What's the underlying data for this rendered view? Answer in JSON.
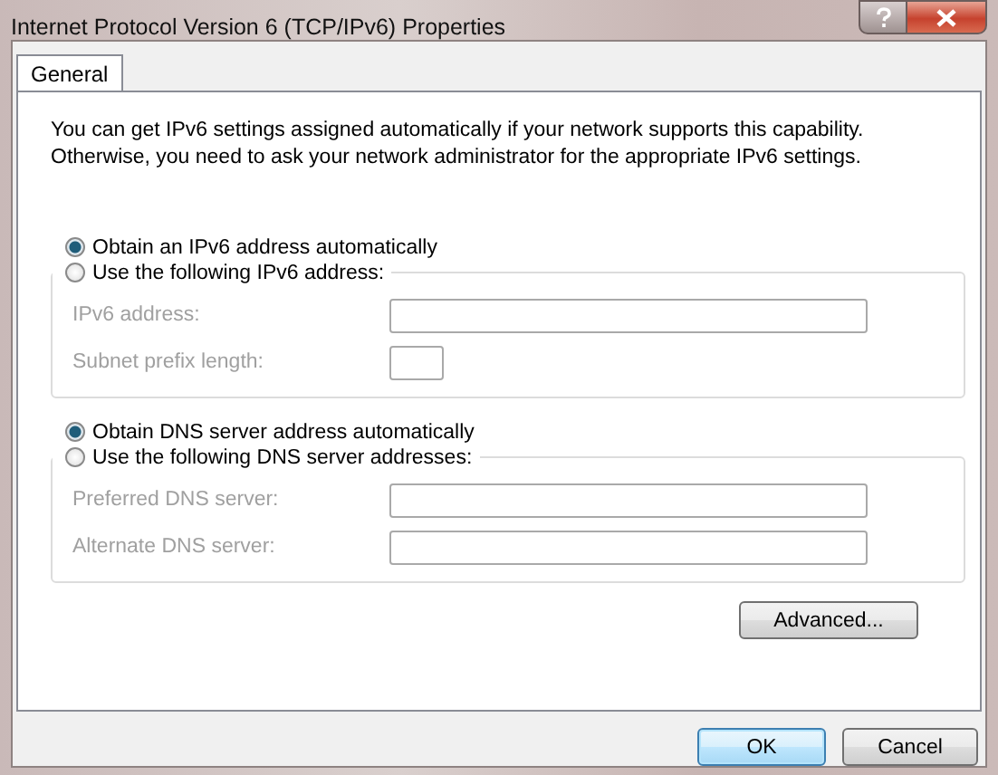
{
  "window": {
    "title": "Internet Protocol Version 6 (TCP/IPv6) Properties"
  },
  "tabs": [
    {
      "label": "General",
      "selected": true
    }
  ],
  "description": "You can get IPv6 settings assigned automatically if your network supports this capability. Otherwise, you need to ask your network administrator for the appropriate IPv6 settings.",
  "sections": [
    {
      "auto_option": {
        "label": "Obtain an IPv6 address automatically",
        "selected": true
      },
      "manual_option": {
        "label": "Use the following IPv6 address:",
        "selected": false
      },
      "fields": [
        {
          "label": "IPv6 address:",
          "kind": "long",
          "disabled": true
        },
        {
          "label": "Subnet prefix length:",
          "kind": "short",
          "disabled": true
        }
      ]
    },
    {
      "auto_option": {
        "label": "Obtain DNS server address automatically",
        "selected": true
      },
      "manual_option": {
        "label": "Use the following DNS server addresses:",
        "selected": false
      },
      "fields": [
        {
          "label": "Preferred DNS server:",
          "kind": "long",
          "disabled": true
        },
        {
          "label": "Alternate DNS server:",
          "kind": "long",
          "disabled": true
        }
      ]
    }
  ],
  "advanced_button": "Advanced...",
  "buttons": [
    {
      "label": "OK",
      "kind": "default"
    },
    {
      "label": "Cancel",
      "kind": "normal"
    }
  ]
}
